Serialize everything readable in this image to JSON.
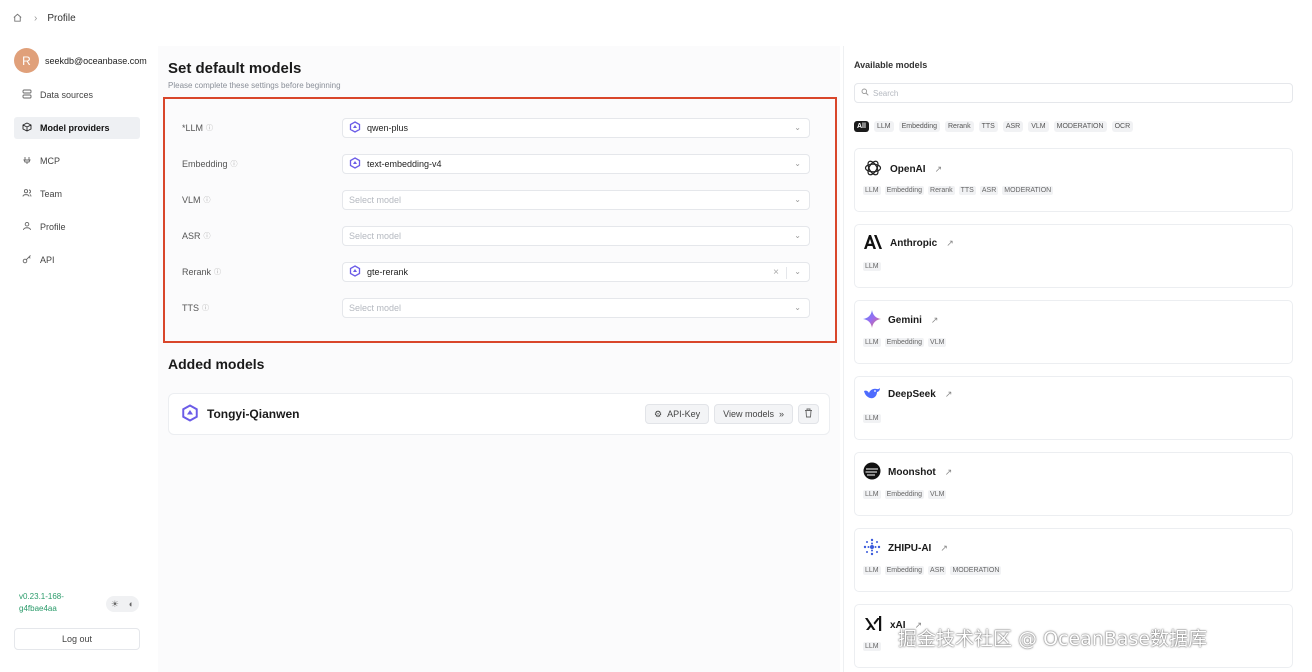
{
  "breadcrumb": {
    "home_icon": "home-icon",
    "current": "Profile"
  },
  "user": {
    "avatar_letter": "R",
    "email": "seekdb@oceanbase.com"
  },
  "sidebar": {
    "items": [
      {
        "label": "Data sources",
        "icon": "database-icon",
        "active": false
      },
      {
        "label": "Model providers",
        "icon": "cube-icon",
        "active": true
      },
      {
        "label": "MCP",
        "icon": "mcp-icon",
        "active": false
      },
      {
        "label": "Team",
        "icon": "users-icon",
        "active": false
      },
      {
        "label": "Profile",
        "icon": "user-icon",
        "active": false
      },
      {
        "label": "API",
        "icon": "key-icon",
        "active": false
      }
    ],
    "version": "v0.23.1-168-g4fbae4aa",
    "logout": "Log out"
  },
  "defaults": {
    "title": "Set default models",
    "subtitle": "Please complete these settings before beginning",
    "rows": [
      {
        "label": "*LLM",
        "value": "qwen-plus",
        "placeholder": ""
      },
      {
        "label": "Embedding",
        "value": "text-embedding-v4",
        "placeholder": ""
      },
      {
        "label": "VLM",
        "value": "",
        "placeholder": "Select model"
      },
      {
        "label": "ASR",
        "value": "",
        "placeholder": "Select model"
      },
      {
        "label": "Rerank",
        "value": "gte-rerank",
        "placeholder": ""
      },
      {
        "label": "TTS",
        "value": "",
        "placeholder": "Select model"
      }
    ]
  },
  "added": {
    "title": "Added models",
    "providers": [
      {
        "name": "Tongyi-Qianwen",
        "api_key": "API-Key",
        "view_models": "View models"
      }
    ]
  },
  "available": {
    "title": "Available models",
    "search_placeholder": "Search",
    "filters": [
      "All",
      "LLM",
      "Embedding",
      "Rerank",
      "TTS",
      "ASR",
      "VLM",
      "MODERATION",
      "OCR"
    ],
    "providers": [
      {
        "name": "OpenAI",
        "tags": [
          "LLM",
          "Embedding",
          "Rerank",
          "TTS",
          "ASR",
          "MODERATION"
        ]
      },
      {
        "name": "Anthropic",
        "tags": [
          "LLM"
        ]
      },
      {
        "name": "Gemini",
        "tags": [
          "LLM",
          "Embedding",
          "VLM"
        ]
      },
      {
        "name": "DeepSeek",
        "tags": [
          "LLM"
        ]
      },
      {
        "name": "Moonshot",
        "tags": [
          "LLM",
          "Embedding",
          "VLM"
        ]
      },
      {
        "name": "ZHIPU-AI",
        "tags": [
          "LLM",
          "Embedding",
          "ASR",
          "MODERATION"
        ]
      },
      {
        "name": "xAI",
        "tags": [
          "LLM"
        ]
      }
    ]
  },
  "watermark": "掘金技术社区 @ OceanBase数据库",
  "colors": {
    "accent_border": "#d9462b",
    "version_text": "#2a9b6a",
    "avatar_bg": "#e0a07a"
  }
}
